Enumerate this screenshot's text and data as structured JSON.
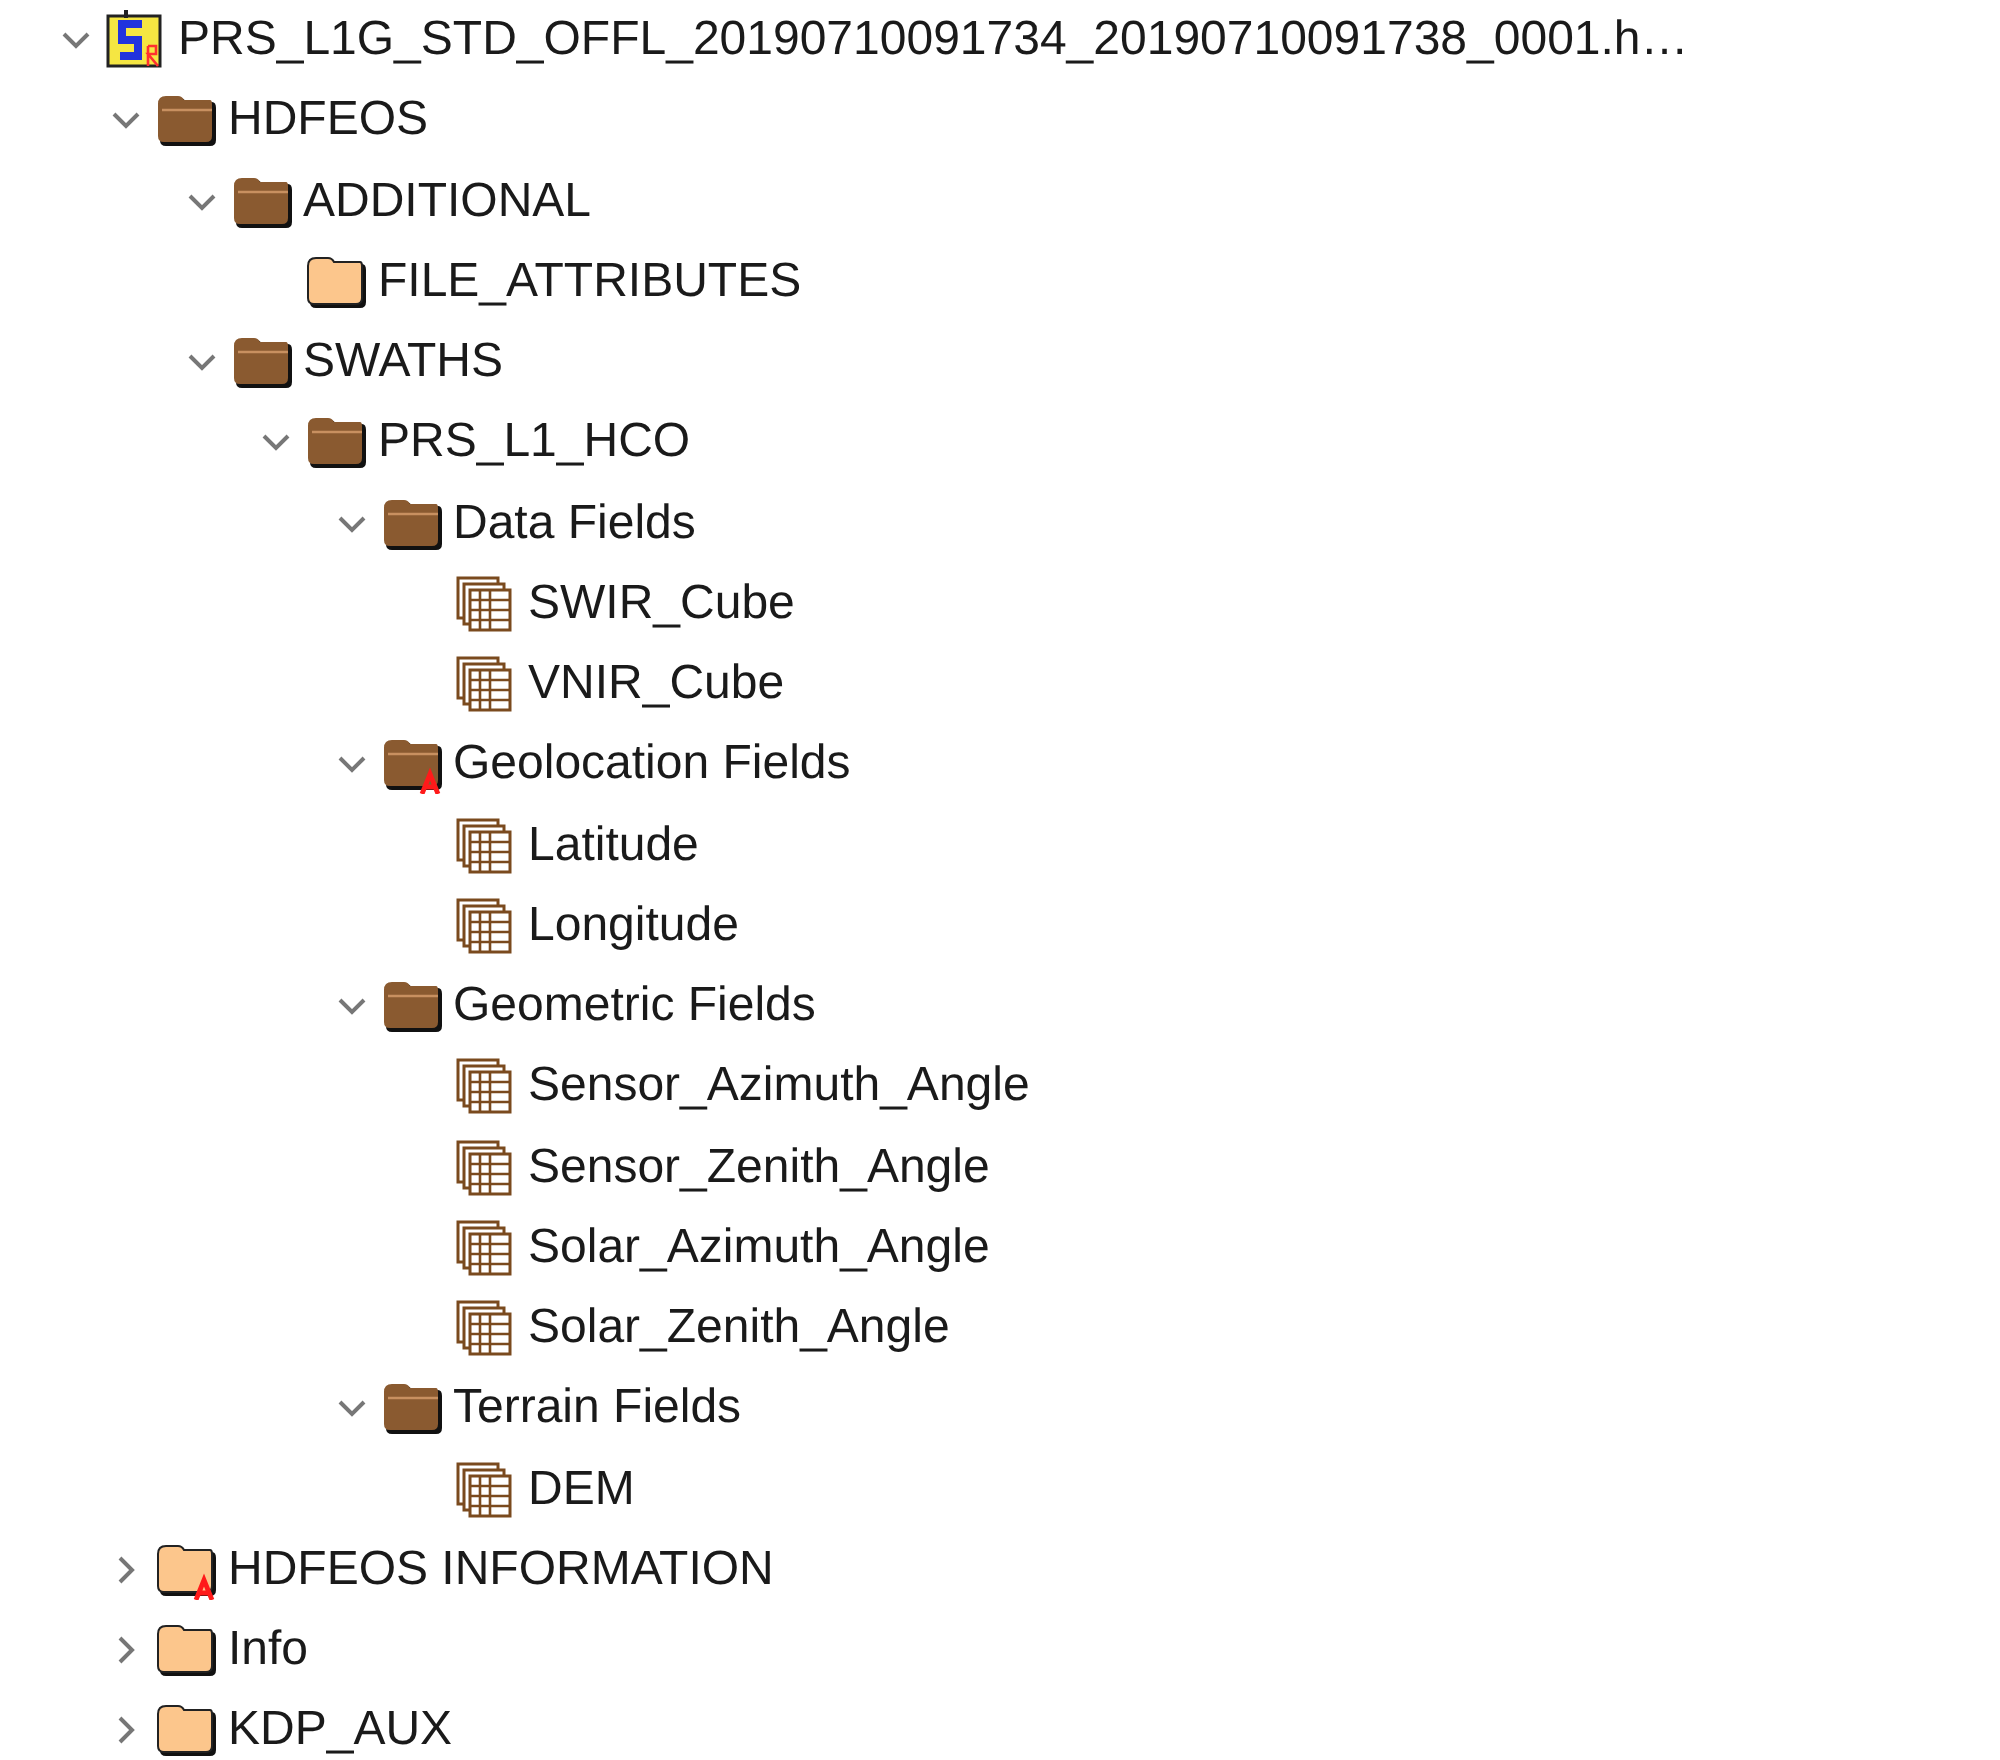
{
  "tree": [
    {
      "kind": "file",
      "label": "PRS_L1G_STD_OFFL_20190710091734_20190710091738_0001.h…",
      "expanded": true,
      "has_attributes": false,
      "children": [
        {
          "kind": "group",
          "label": "HDFEOS",
          "expanded": true,
          "has_attributes": false,
          "children": [
            {
              "kind": "group",
              "label": "ADDITIONAL",
              "expanded": true,
              "has_attributes": false,
              "children": [
                {
                  "kind": "group",
                  "label": "FILE_ATTRIBUTES",
                  "has_attributes": false
                }
              ]
            },
            {
              "kind": "group",
              "label": "SWATHS",
              "expanded": true,
              "has_attributes": false,
              "children": [
                {
                  "kind": "group",
                  "label": "PRS_L1_HCO",
                  "expanded": true,
                  "has_attributes": false,
                  "children": [
                    {
                      "kind": "group",
                      "label": "Data Fields",
                      "expanded": true,
                      "has_attributes": false,
                      "children": [
                        {
                          "kind": "dataset",
                          "label": "SWIR_Cube",
                          "has_attributes": false
                        },
                        {
                          "kind": "dataset",
                          "label": "VNIR_Cube",
                          "has_attributes": false
                        }
                      ]
                    },
                    {
                      "kind": "group",
                      "label": "Geolocation Fields",
                      "expanded": true,
                      "has_attributes": true,
                      "children": [
                        {
                          "kind": "dataset",
                          "label": "Latitude",
                          "has_attributes": false
                        },
                        {
                          "kind": "dataset",
                          "label": "Longitude",
                          "has_attributes": false
                        }
                      ]
                    },
                    {
                      "kind": "group",
                      "label": "Geometric Fields",
                      "expanded": true,
                      "has_attributes": false,
                      "children": [
                        {
                          "kind": "dataset",
                          "label": "Sensor_Azimuth_Angle",
                          "has_attributes": false
                        },
                        {
                          "kind": "dataset",
                          "label": "Sensor_Zenith_Angle",
                          "has_attributes": false
                        },
                        {
                          "kind": "dataset",
                          "label": "Solar_Azimuth_Angle",
                          "has_attributes": false
                        },
                        {
                          "kind": "dataset",
                          "label": "Solar_Zenith_Angle",
                          "has_attributes": false
                        }
                      ]
                    },
                    {
                      "kind": "group",
                      "label": "Terrain Fields",
                      "expanded": true,
                      "has_attributes": false,
                      "children": [
                        {
                          "kind": "dataset",
                          "label": "DEM",
                          "has_attributes": false
                        }
                      ]
                    }
                  ]
                }
              ]
            }
          ]
        },
        {
          "kind": "group",
          "label": "HDFEOS INFORMATION",
          "expanded": false,
          "has_attributes": true
        },
        {
          "kind": "group",
          "label": "Info",
          "expanded": false,
          "has_attributes": false
        },
        {
          "kind": "group",
          "label": "KDP_AUX",
          "expanded": false,
          "has_attributes": false
        }
      ]
    }
  ]
}
